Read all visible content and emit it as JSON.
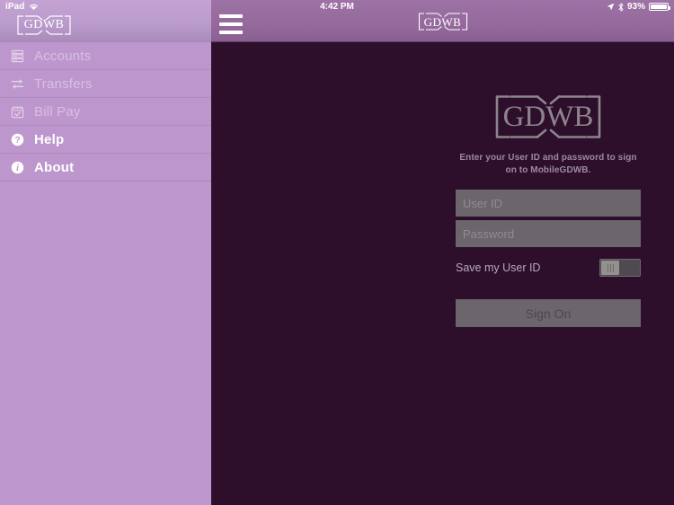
{
  "statusbar": {
    "device": "iPad",
    "wifi_icon": "wifi-icon",
    "time": "4:42 PM",
    "location_icon": "location-arrow-icon",
    "bluetooth_icon": "bluetooth-icon",
    "battery_percent": "93%",
    "battery_icon": "battery-icon"
  },
  "sidebar": {
    "logo_text": "GDWB",
    "items": [
      {
        "label": "Accounts",
        "icon": "accounts-icon",
        "state": "disabled"
      },
      {
        "label": "Transfers",
        "icon": "transfers-icon",
        "state": "disabled"
      },
      {
        "label": "Bill Pay",
        "icon": "calendar-check-icon",
        "state": "disabled"
      },
      {
        "label": "Help",
        "icon": "question-circle-icon",
        "state": "enabled"
      },
      {
        "label": "About",
        "icon": "info-circle-icon",
        "state": "enabled"
      }
    ]
  },
  "navbar": {
    "menu_icon": "hamburger-menu-icon",
    "logo_text": "GDWB"
  },
  "login": {
    "logo_text": "GDWB",
    "instructions": "Enter your User ID and password to sign on to MobileGDWB.",
    "user_id": {
      "value": "",
      "placeholder": "User ID"
    },
    "password": {
      "value": "",
      "placeholder": "Password"
    },
    "save_user_id_label": "Save my User ID",
    "save_user_id_state": "off",
    "sign_on_label": "Sign On"
  },
  "colors": {
    "sidebar_bg": "#bd96ce",
    "navbar_bg": "#95699c",
    "main_bg": "#2d0f2b",
    "field_bg": "#6b666b",
    "logo_gray": "#8d848d"
  }
}
